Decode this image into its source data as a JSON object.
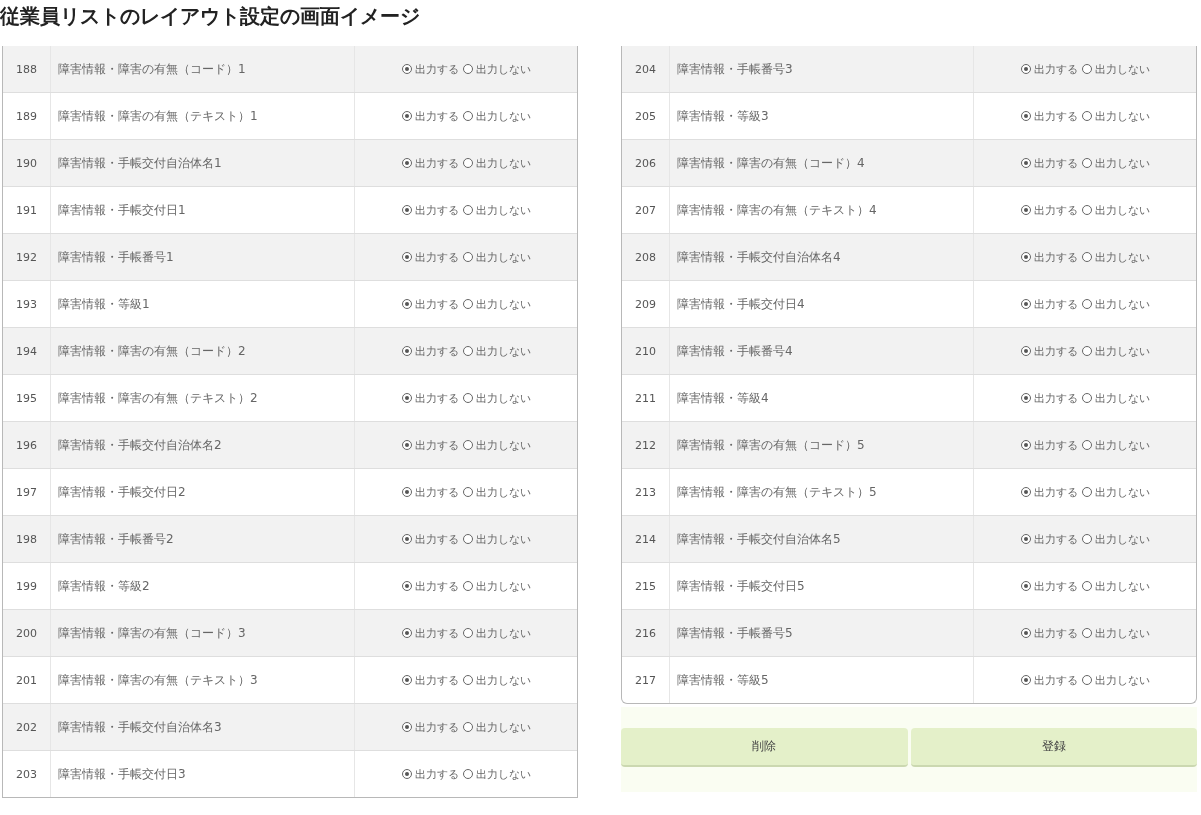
{
  "title": "従業員リストのレイアウト設定の画面イメージ",
  "tables": [
    {
      "rows": [
        {
          "number": "188",
          "label": "障害情報・障害の有無（コード）1",
          "options": [
            {
              "label": "出力する",
              "selected": true
            },
            {
              "label": "出力しない",
              "selected": false
            }
          ]
        },
        {
          "number": "189",
          "label": "障害情報・障害の有無（テキスト）1",
          "options": [
            {
              "label": "出力する",
              "selected": true
            },
            {
              "label": "出力しない",
              "selected": false
            }
          ]
        },
        {
          "number": "190",
          "label": "障害情報・手帳交付自治体名1",
          "options": [
            {
              "label": "出力する",
              "selected": true
            },
            {
              "label": "出力しない",
              "selected": false
            }
          ]
        },
        {
          "number": "191",
          "label": "障害情報・手帳交付日1",
          "options": [
            {
              "label": "出力する",
              "selected": true
            },
            {
              "label": "出力しない",
              "selected": false
            }
          ]
        },
        {
          "number": "192",
          "label": "障害情報・手帳番号1",
          "options": [
            {
              "label": "出力する",
              "selected": true
            },
            {
              "label": "出力しない",
              "selected": false
            }
          ]
        },
        {
          "number": "193",
          "label": "障害情報・等級1",
          "options": [
            {
              "label": "出力する",
              "selected": true
            },
            {
              "label": "出力しない",
              "selected": false
            }
          ]
        },
        {
          "number": "194",
          "label": "障害情報・障害の有無（コード）2",
          "options": [
            {
              "label": "出力する",
              "selected": true
            },
            {
              "label": "出力しない",
              "selected": false
            }
          ]
        },
        {
          "number": "195",
          "label": "障害情報・障害の有無（テキスト）2",
          "options": [
            {
              "label": "出力する",
              "selected": true
            },
            {
              "label": "出力しない",
              "selected": false
            }
          ]
        },
        {
          "number": "196",
          "label": "障害情報・手帳交付自治体名2",
          "options": [
            {
              "label": "出力する",
              "selected": true
            },
            {
              "label": "出力しない",
              "selected": false
            }
          ]
        },
        {
          "number": "197",
          "label": "障害情報・手帳交付日2",
          "options": [
            {
              "label": "出力する",
              "selected": true
            },
            {
              "label": "出力しない",
              "selected": false
            }
          ]
        },
        {
          "number": "198",
          "label": "障害情報・手帳番号2",
          "options": [
            {
              "label": "出力する",
              "selected": true
            },
            {
              "label": "出力しない",
              "selected": false
            }
          ]
        },
        {
          "number": "199",
          "label": "障害情報・等級2",
          "options": [
            {
              "label": "出力する",
              "selected": true
            },
            {
              "label": "出力しない",
              "selected": false
            }
          ]
        },
        {
          "number": "200",
          "label": "障害情報・障害の有無（コード）3",
          "options": [
            {
              "label": "出力する",
              "selected": true
            },
            {
              "label": "出力しない",
              "selected": false
            }
          ]
        },
        {
          "number": "201",
          "label": "障害情報・障害の有無（テキスト）3",
          "options": [
            {
              "label": "出力する",
              "selected": true
            },
            {
              "label": "出力しない",
              "selected": false
            }
          ]
        },
        {
          "number": "202",
          "label": "障害情報・手帳交付自治体名3",
          "options": [
            {
              "label": "出力する",
              "selected": true
            },
            {
              "label": "出力しない",
              "selected": false
            }
          ]
        },
        {
          "number": "203",
          "label": "障害情報・手帳交付日3",
          "options": [
            {
              "label": "出力する",
              "selected": true
            },
            {
              "label": "出力しない",
              "selected": false
            }
          ]
        }
      ]
    },
    {
      "rows": [
        {
          "number": "204",
          "label": "障害情報・手帳番号3",
          "options": [
            {
              "label": "出力する",
              "selected": true
            },
            {
              "label": "出力しない",
              "selected": false
            }
          ]
        },
        {
          "number": "205",
          "label": "障害情報・等級3",
          "options": [
            {
              "label": "出力する",
              "selected": true
            },
            {
              "label": "出力しない",
              "selected": false
            }
          ]
        },
        {
          "number": "206",
          "label": "障害情報・障害の有無（コード）4",
          "options": [
            {
              "label": "出力する",
              "selected": true
            },
            {
              "label": "出力しない",
              "selected": false
            }
          ]
        },
        {
          "number": "207",
          "label": "障害情報・障害の有無（テキスト）4",
          "options": [
            {
              "label": "出力する",
              "selected": true
            },
            {
              "label": "出力しない",
              "selected": false
            }
          ]
        },
        {
          "number": "208",
          "label": "障害情報・手帳交付自治体名4",
          "options": [
            {
              "label": "出力する",
              "selected": true
            },
            {
              "label": "出力しない",
              "selected": false
            }
          ]
        },
        {
          "number": "209",
          "label": "障害情報・手帳交付日4",
          "options": [
            {
              "label": "出力する",
              "selected": true
            },
            {
              "label": "出力しない",
              "selected": false
            }
          ]
        },
        {
          "number": "210",
          "label": "障害情報・手帳番号4",
          "options": [
            {
              "label": "出力する",
              "selected": true
            },
            {
              "label": "出力しない",
              "selected": false
            }
          ]
        },
        {
          "number": "211",
          "label": "障害情報・等級4",
          "options": [
            {
              "label": "出力する",
              "selected": true
            },
            {
              "label": "出力しない",
              "selected": false
            }
          ]
        },
        {
          "number": "212",
          "label": "障害情報・障害の有無（コード）5",
          "options": [
            {
              "label": "出力する",
              "selected": true
            },
            {
              "label": "出力しない",
              "selected": false
            }
          ]
        },
        {
          "number": "213",
          "label": "障害情報・障害の有無（テキスト）5",
          "options": [
            {
              "label": "出力する",
              "selected": true
            },
            {
              "label": "出力しない",
              "selected": false
            }
          ]
        },
        {
          "number": "214",
          "label": "障害情報・手帳交付自治体名5",
          "options": [
            {
              "label": "出力する",
              "selected": true
            },
            {
              "label": "出力しない",
              "selected": false
            }
          ]
        },
        {
          "number": "215",
          "label": "障害情報・手帳交付日5",
          "options": [
            {
              "label": "出力する",
              "selected": true
            },
            {
              "label": "出力しない",
              "selected": false
            }
          ]
        },
        {
          "number": "216",
          "label": "障害情報・手帳番号5",
          "options": [
            {
              "label": "出力する",
              "selected": true
            },
            {
              "label": "出力しない",
              "selected": false
            }
          ]
        },
        {
          "number": "217",
          "label": "障害情報・等級5",
          "options": [
            {
              "label": "出力する",
              "selected": true
            },
            {
              "label": "出力しない",
              "selected": false
            }
          ]
        }
      ]
    }
  ],
  "buttons": [
    "削除",
    "登録"
  ]
}
